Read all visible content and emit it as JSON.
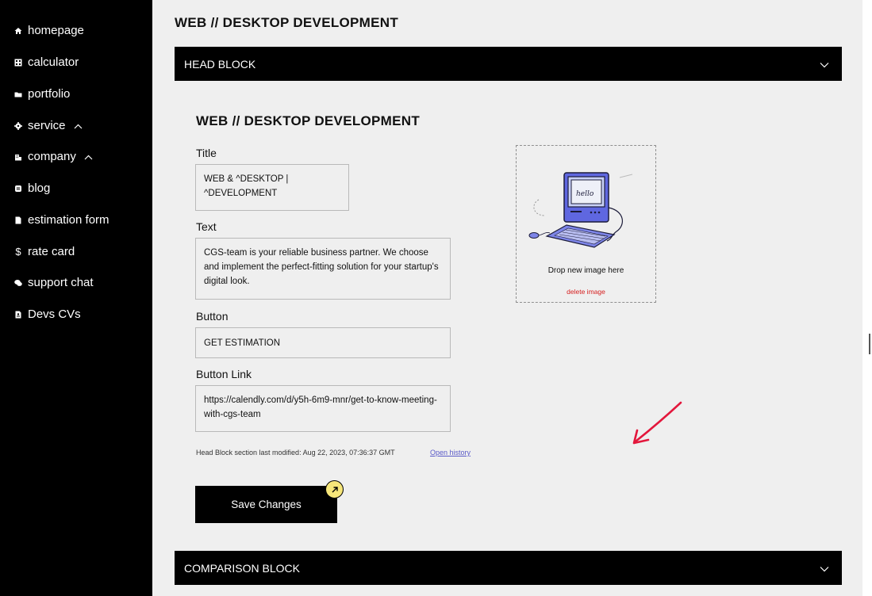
{
  "sidebar": {
    "items": [
      {
        "label": "homepage",
        "icon": "home-icon"
      },
      {
        "label": "calculator",
        "icon": "calculator-icon"
      },
      {
        "label": "portfolio",
        "icon": "folder-icon"
      },
      {
        "label": "service",
        "icon": "gear-icon",
        "expandable": true
      },
      {
        "label": "company",
        "icon": "building-icon",
        "expandable": true
      },
      {
        "label": "blog",
        "icon": "blog-icon"
      },
      {
        "label": "estimation form",
        "icon": "document-icon"
      },
      {
        "label": "rate card",
        "icon": "dollar-icon"
      },
      {
        "label": "support chat",
        "icon": "chat-icon"
      },
      {
        "label": "Devs CVs",
        "icon": "cv-icon"
      }
    ]
  },
  "main": {
    "page_title": "WEB // DESKTOP DEVELOPMENT",
    "head_block": {
      "label": "HEAD BLOCK",
      "section_title": "WEB // DESKTOP DEVELOPMENT",
      "fields": {
        "title": {
          "label": "Title",
          "value": "WEB & ^DESKTOP |\n^DEVELOPMENT"
        },
        "text": {
          "label": "Text",
          "value": "CGS-team is your reliable business partner. We choose and implement the perfect-fitting solution for your startup's digital look."
        },
        "button": {
          "label": "Button",
          "value": "GET ESTIMATION"
        },
        "button_link": {
          "label": "Button Link",
          "value": "https://calendly.com/d/y5h-6m9-mnr/get-to-know-meeting-with-cgs-team"
        }
      },
      "image": {
        "drop_text": "Drop new image here",
        "delete_label": "delete image",
        "screen_text": "hello"
      },
      "last_modified": "Head Block section last modified: Aug 22, 2023, 07:36:37 GMT",
      "history_link": "Open history",
      "save_label": "Save Changes"
    },
    "comparison_block": {
      "label": "COMPARISON BLOCK"
    }
  },
  "colors": {
    "sidebar_bg": "#000000",
    "main_bg": "#efefef",
    "badge": "#f6e67a",
    "delete": "#d62020",
    "link": "#5a5ac8",
    "annotation_arrow": "#e3173c",
    "illustration_accent": "#5f67e0"
  }
}
